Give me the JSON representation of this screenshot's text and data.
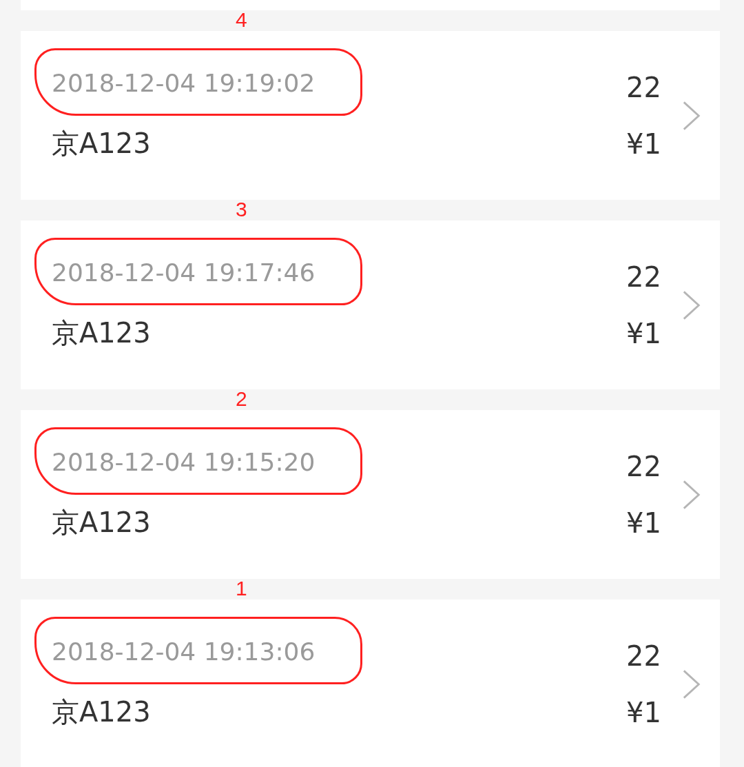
{
  "records": [
    {
      "time": "2018-12-04 19:19:02",
      "plate": "京A123",
      "count": "22",
      "price": "¥1",
      "circled": true,
      "mark": "4"
    },
    {
      "time": "2018-12-04 19:17:46",
      "plate": "京A123",
      "count": "22",
      "price": "¥1",
      "circled": true,
      "mark": "3"
    },
    {
      "time": "2018-12-04 19:15:20",
      "plate": "京A123",
      "count": "22",
      "price": "¥1",
      "circled": true,
      "mark": "2"
    },
    {
      "time": "2018-12-04 19:13:06",
      "plate": "京A123",
      "count": "22",
      "price": "¥1",
      "circled": true,
      "mark": "1"
    }
  ]
}
